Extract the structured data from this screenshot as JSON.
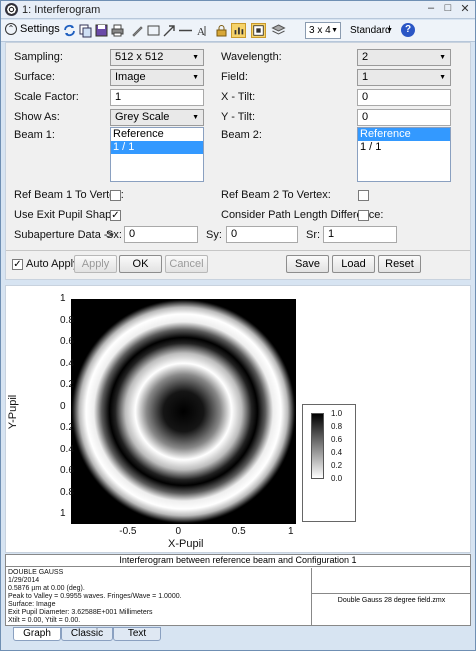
{
  "window": {
    "title": "1: Interferogram",
    "controls": [
      "–",
      "□",
      "✕"
    ]
  },
  "toolbar": {
    "settings_label": "Settings",
    "layout_select": "3 x 4",
    "style_select": "Standard",
    "icons": [
      "refresh-icon",
      "copy-icon",
      "save-icon",
      "print-icon",
      "pencil-icon",
      "rectangle-icon",
      "arrow-icon",
      "line-icon",
      "text-icon",
      "lock-icon",
      "chart-icon",
      "grid-icon",
      "layers-icon",
      "help-icon"
    ]
  },
  "settings": {
    "sampling_label": "Sampling:",
    "sampling_value": "512 x 512",
    "surface_label": "Surface:",
    "surface_value": "Image",
    "scale_label": "Scale Factor:",
    "scale_value": "1",
    "showas_label": "Show As:",
    "showas_value": "Grey Scale",
    "beam1_label": "Beam 1:",
    "beam1_items": [
      "Reference",
      "1 / 1"
    ],
    "beam1_selected": 1,
    "wavelength_label": "Wavelength:",
    "wavelength_value": "2",
    "field_label": "Field:",
    "field_value": "1",
    "xtilt_label": "X - Tilt:",
    "xtilt_value": "0",
    "ytilt_label": "Y - Tilt:",
    "ytilt_value": "0",
    "beam2_label": "Beam 2:",
    "beam2_items": [
      "Reference",
      "1 / 1"
    ],
    "beam2_selected": 0,
    "ref1_label": "Ref Beam 1 To Vertex:",
    "ref1_checked": false,
    "ref2_label": "Ref Beam 2 To Vertex:",
    "ref2_checked": false,
    "exitpupil_label": "Use Exit Pupil Shape:",
    "exitpupil_checked": true,
    "pathlength_label": "Consider Path Length Difference:",
    "pathlength_checked": false,
    "subap_label": "Subaperture Data ->",
    "sx_label": "Sx:",
    "sx_value": "0",
    "sy_label": "Sy:",
    "sy_value": "0",
    "sr_label": "Sr:",
    "sr_value": "1"
  },
  "buttons": {
    "auto_apply": "Auto Apply",
    "auto_apply_checked": true,
    "apply": "Apply",
    "ok": "OK",
    "cancel": "Cancel",
    "save": "Save",
    "load": "Load",
    "reset": "Reset"
  },
  "chart_data": {
    "type": "heatmap",
    "title": "",
    "xlabel": "X-Pupil",
    "ylabel": "Y-Pupil",
    "x_ticks": [
      "-0.5",
      "0",
      "0.5",
      "1"
    ],
    "y_ticks": [
      "1",
      "0.8",
      "0.6",
      "0.4",
      "0.2",
      "0",
      "0.2",
      "0.4",
      "0.6",
      "0.8",
      "1"
    ],
    "colorbar_ticks": [
      "1.0",
      "0.8",
      "0.6",
      "0.4",
      "0.2",
      "0.0"
    ],
    "colormap": "grey",
    "pattern": "concentric fringes",
    "fringes_per_wave": 1.0
  },
  "info": {
    "title": "Interferogram between reference beam and Configuration 1",
    "lines": [
      "DOUBLE GAUSS",
      "1/29/2014",
      "0.5876 µm at 0.00 (deg).",
      "Peak to Valley = 0.9955 waves. Fringes/Wave = 1.0000.",
      "Surface: Image",
      "Exit Pupil Diameter: 3.62588E+001 Millimeters",
      "Xtilt = 0.00, Ytilt = 0.00."
    ],
    "file": "Double Gauss 28 degree field.zmx"
  },
  "tabs": [
    "Graph",
    "Classic",
    "Text"
  ],
  "active_tab": 0
}
